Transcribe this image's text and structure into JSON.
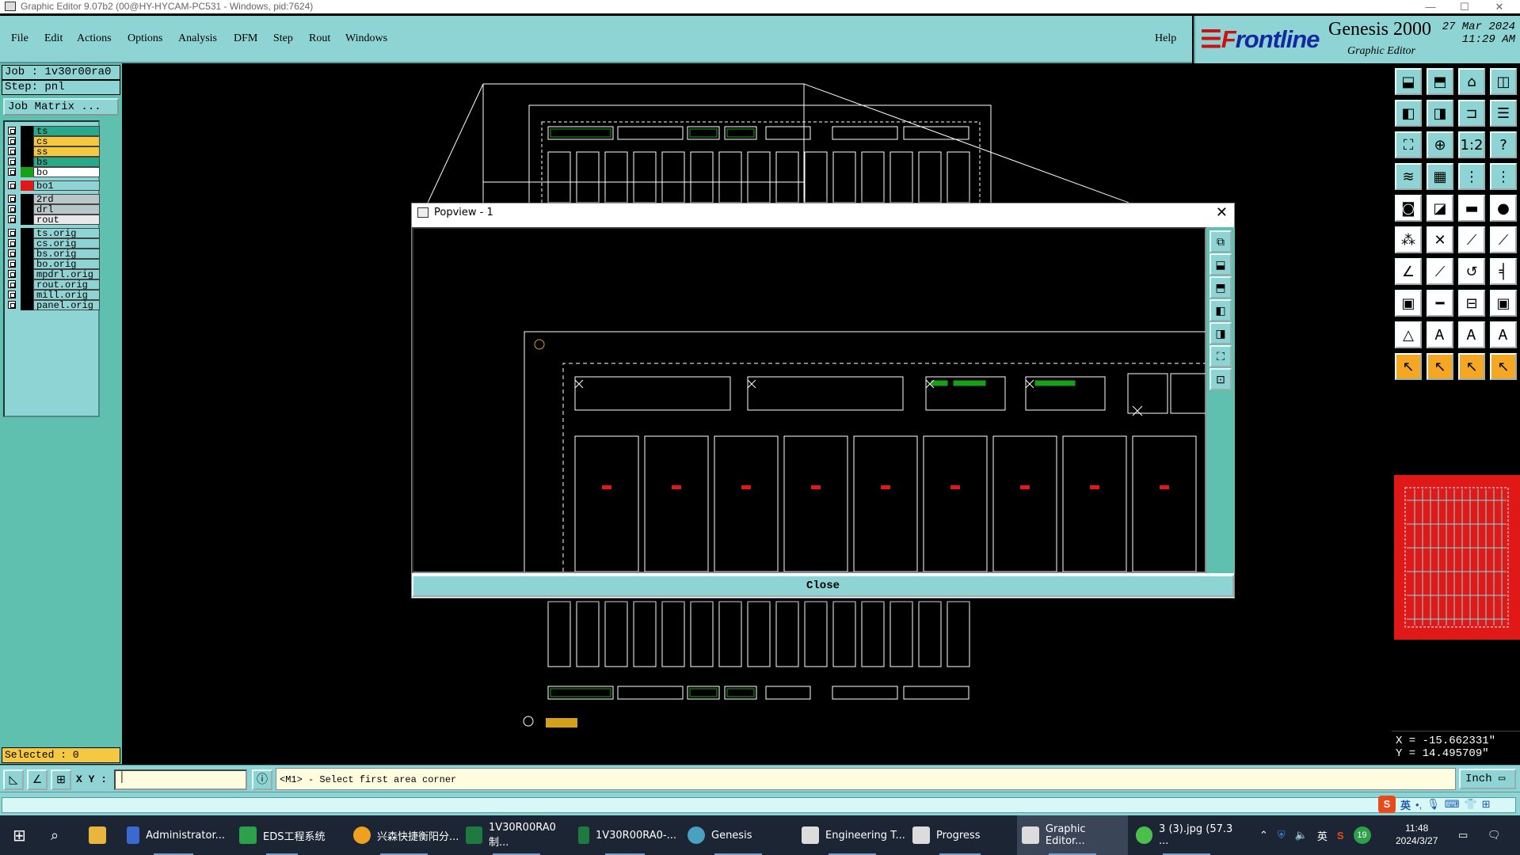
{
  "window": {
    "title": "Graphic Editor 9.07b2 (00@HY-HYCAM-PC531 - Windows, pid:7624)",
    "minimize": "—",
    "maximize": "☐",
    "close": "✕"
  },
  "menu": {
    "items": [
      "File",
      "Edit",
      "Actions",
      "Options",
      "Analysis",
      "DFM",
      "Step",
      "Rout",
      "Windows"
    ],
    "help": "Help"
  },
  "brand": {
    "logo_f": "F",
    "logo_rest": "rontline",
    "product": "Genesis 2000",
    "subtitle": "Graphic Editor",
    "date": "27 Mar 2024",
    "time": "11:29 AM"
  },
  "job": {
    "job_line": "Job : 1v30r00ra0",
    "step_line": "Step: pnl",
    "matrix_button": "Job Matrix ..."
  },
  "layers": [
    {
      "name": "ts",
      "color": "#2aa88a",
      "swatch": "#000"
    },
    {
      "name": "cs",
      "color": "#f5c842",
      "swatch": "#000"
    },
    {
      "name": "ss",
      "color": "#f5c842",
      "swatch": "#000"
    },
    {
      "name": "bs",
      "color": "#2aa88a",
      "swatch": "#000"
    },
    {
      "name": "bo",
      "color": "#ffffff",
      "swatch": "#19a019"
    },
    {
      "name": "bo1",
      "color": "#8fd4d4",
      "swatch": "#e01818"
    },
    {
      "name": "2rd",
      "color": "#b8c8c8",
      "swatch": "#000"
    },
    {
      "name": "drl",
      "color": "#b8c8c8",
      "swatch": "#000"
    },
    {
      "name": "rout",
      "color": "#e8e8e8",
      "swatch": "#000"
    },
    {
      "name": "ts.orig",
      "color": "#8fd4d4",
      "swatch": "#000"
    },
    {
      "name": "cs.orig",
      "color": "#8fd4d4",
      "swatch": "#000"
    },
    {
      "name": "bs.orig",
      "color": "#8fd4d4",
      "swatch": "#000"
    },
    {
      "name": "bo.orig",
      "color": "#8fd4d4",
      "swatch": "#000"
    },
    {
      "name": "mpdrl.orig",
      "color": "#8fd4d4",
      "swatch": "#000"
    },
    {
      "name": "rout.orig",
      "color": "#8fd4d4",
      "swatch": "#000"
    },
    {
      "name": "mill.orig",
      "color": "#8fd4d4",
      "swatch": "#000"
    },
    {
      "name": "panel.orig",
      "color": "#8fd4d4",
      "swatch": "#000"
    }
  ],
  "selected": "Selected : 0",
  "popview": {
    "title": "Popview - 1",
    "close_icon": "✕",
    "close_button": "Close"
  },
  "coords": {
    "x": "X = -15.662331\"",
    "y": "Y = 14.495709\""
  },
  "command": {
    "xy_label": "X Y :",
    "prompt": "<M1> - Select first area corner",
    "unit": "Inch"
  },
  "ime": {
    "lang": "英"
  },
  "taskbar": {
    "items": [
      "Administrator...",
      "EDS工程系统",
      "兴森快捷衡阳分...",
      "1V30R00RA0制...",
      "1V30R00RA0-...",
      "Genesis",
      "Engineering T...",
      "Progress",
      "Graphic Editor...",
      "3 (3).jpg (57.3 ..."
    ],
    "tray_lang": "英",
    "badge": "19",
    "time": "11:48",
    "date": "2024/3/27"
  }
}
